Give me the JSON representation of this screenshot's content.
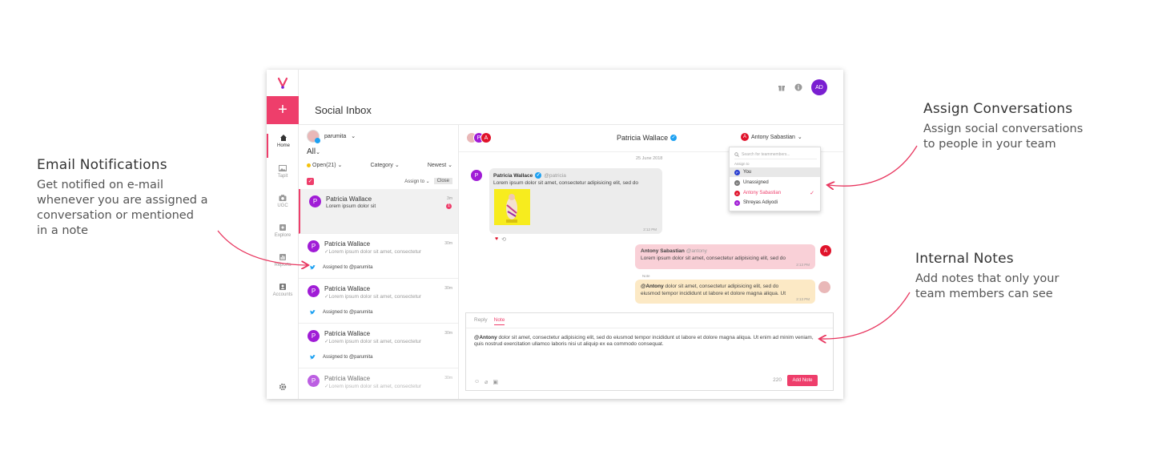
{
  "annotations": {
    "email": {
      "title": "Email Notifications",
      "lines": [
        "Get notified on e-mail",
        "whenever you are assigned a",
        "conversation or mentioned",
        "in a note"
      ]
    },
    "assign": {
      "title": "Assign Conversations",
      "lines": [
        "Assign social conversations",
        "to people in your team"
      ]
    },
    "notes": {
      "title": "Internal Notes",
      "lines": [
        "Add notes that only your",
        "team members can see"
      ]
    }
  },
  "app": {
    "page_title": "Social Inbox",
    "user_initials": "AD",
    "nav": [
      {
        "label": "Home",
        "icon": "home-icon"
      },
      {
        "label": "Tapit",
        "icon": "image-icon"
      },
      {
        "label": "UGC",
        "icon": "camera-icon"
      },
      {
        "label": "Explore",
        "icon": "explore-icon"
      },
      {
        "label": "Reports",
        "icon": "chart-icon"
      },
      {
        "label": "Accounts",
        "icon": "accounts-icon"
      }
    ],
    "plus_label": "+",
    "colors": {
      "accent": "#ee3e6b",
      "avatar_purple": "#a01cd6",
      "assignee_red": "#e0132b",
      "ad_avatar": "#7a1fd1"
    }
  },
  "list": {
    "account": "parumita",
    "all_label": "All",
    "filters": {
      "open": "Open(21)",
      "category": "Category",
      "sort": "Newest"
    },
    "assign_to": "Assign to",
    "close": "Close",
    "items": [
      {
        "initial": "P",
        "name": "Patricia Wallace",
        "snippet": "Lorem ipsum dolor sit",
        "time": "3m",
        "unread": "1"
      },
      {
        "initial": "P",
        "name": "Patricia Wallace",
        "snippet": "✓Lorem ipsum dolor sit amet, consectetur",
        "time": "30m",
        "assigned": "Assigned to @parumita"
      },
      {
        "initial": "P",
        "name": "Patricia Wallace",
        "snippet": "✓Lorem ipsum dolor sit amet, consectetur",
        "time": "30m",
        "assigned": "Assigned to @parumita"
      },
      {
        "initial": "P",
        "name": "Patricia Wallace",
        "snippet": "✓Lorem ipsum dolor sit amet, consectetur",
        "time": "30m",
        "assigned": "Assigned to @parumita"
      },
      {
        "initial": "P",
        "name": "Patricia Wallace",
        "snippet": "✓Lorem ipsum dolor sit amet, consectetur",
        "time": "30m"
      }
    ]
  },
  "pane": {
    "header_avatars": [
      "P",
      "A"
    ],
    "contact_name": "Patricia Wallace",
    "assignee_initial": "A",
    "assignee": "Antony Sabastian",
    "dropdown": {
      "search_placeholder": "Search for teammembers...",
      "label": "Assign to",
      "options": [
        {
          "initial": "P",
          "name": "You",
          "color": "#2a3fd1"
        },
        {
          "initial": "U",
          "name": "Unassigned",
          "color": "#777777"
        },
        {
          "initial": "A",
          "name": "Antony Sabastian",
          "color": "#e0132b"
        },
        {
          "initial": "S",
          "name": "Shreyas Adiyodi",
          "color": "#a01cd6"
        }
      ],
      "check": "✓"
    },
    "date": "25 June 2018",
    "incoming": {
      "initial": "P",
      "author": "Patricia Wallace",
      "handle": "@patricia",
      "text": "Lorem ipsum dolor sit amet, consectetur adipisicing elit, sed do",
      "time": "2:12 PM"
    },
    "outgoing": {
      "initial": "A",
      "author": "Antony Sabastian",
      "handle": "@antony",
      "text": "Lorem ipsum dolor sit amet, consectetur adipisicing elit, sed do",
      "time": "2:13 PM"
    },
    "note": {
      "label": "Note",
      "mention": "@Antony",
      "line1": " dolor sit amet, consectetur adipisicing elit, sed do",
      "line2": "eiusmod tempor incididunt ut labore et dolore magna aliqua. Ut",
      "time": "2:13 PM"
    },
    "composer": {
      "tab_reply": "Reply",
      "tab_note": "Note",
      "mention": "@Antony",
      "text": " dolor sit amet, consectetur adipisicing elit, sed do eiusmod tempor incididunt ut labore et dolore magna aliqua. Ut enim ad minim veniam, quis nostrud exercitation ullamco laboris nisi ut aliquip ex ea commodo consequat.",
      "count": "220",
      "button": "Add Note"
    }
  }
}
